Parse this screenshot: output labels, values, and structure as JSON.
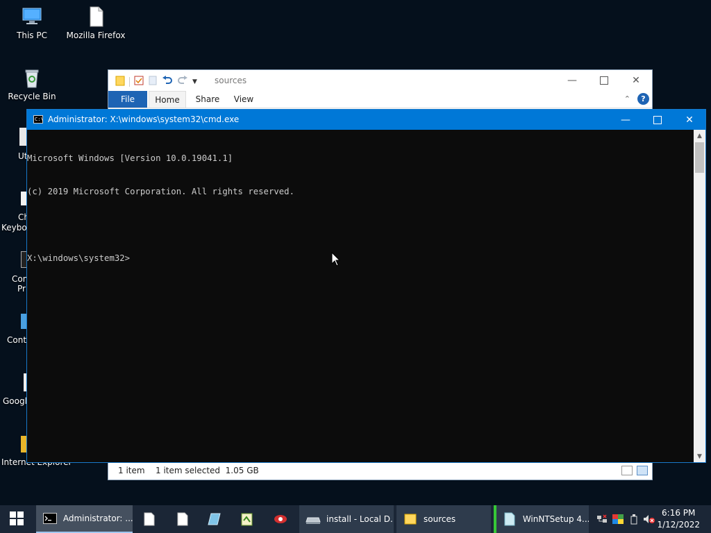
{
  "desktop": {
    "icons": [
      {
        "label": "This PC",
        "icon": "this-pc-icon"
      },
      {
        "label": "Mozilla Firefox",
        "icon": "document-icon"
      },
      {
        "label": "Recycle Bin",
        "icon": "recycle-bin-icon"
      }
    ],
    "partial_labels": [
      "Ut",
      "Ch",
      "Keyboa",
      "Con",
      "Pr",
      "Contr",
      "Google",
      "Internet Explorer"
    ]
  },
  "explorer": {
    "title": "sources",
    "tabs": {
      "file": "File",
      "home": "Home",
      "share": "Share",
      "view": "View"
    },
    "help": "?",
    "status": {
      "item_count": "1 item",
      "selection": "1 item selected  1.05 GB"
    }
  },
  "cmd": {
    "title": "Administrator: X:\\windows\\system32\\cmd.exe",
    "lines": [
      "Microsoft Windows [Version 10.0.19041.1]",
      "(c) 2019 Microsoft Corporation. All rights reserved.",
      "",
      "X:\\windows\\system32>"
    ]
  },
  "taskbar": {
    "buttons": [
      {
        "label": "Administrator: ..."
      },
      {
        "label": "install - Local D..."
      },
      {
        "label": "sources"
      },
      {
        "label": "WinNTSetup 4...."
      }
    ],
    "clock": {
      "time": "6:16 PM",
      "date": "1/12/2022"
    }
  },
  "colors": {
    "desktop_bg": "#05101c",
    "titlebar_blue": "#0078d7",
    "taskbar_bg": "#1b2636",
    "console_bg": "#0c0c0c",
    "console_text": "#cccccc",
    "ribbon_file_tab": "#1e64b4"
  }
}
